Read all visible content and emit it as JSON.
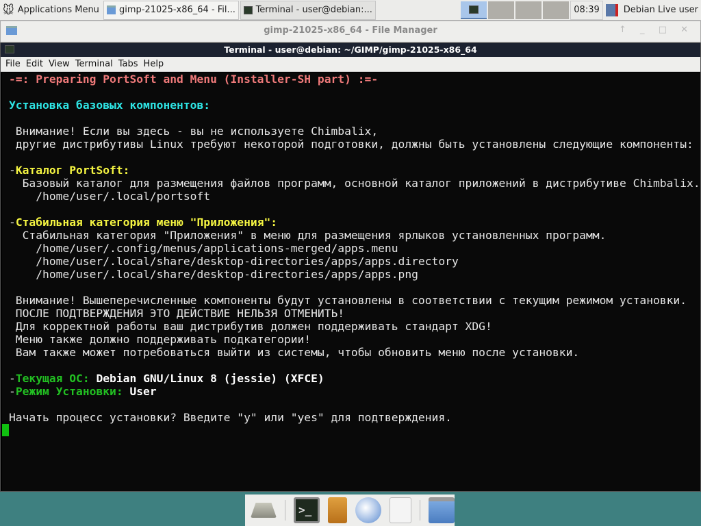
{
  "panel": {
    "app_menu": "Applications Menu",
    "tasks": [
      {
        "label": "gimp-21025-x86_64 - Fil...",
        "icon": "folder-icon"
      },
      {
        "label": "Terminal - user@debian:...",
        "icon": "terminal-icon"
      }
    ],
    "clock": "08:39",
    "user": "Debian Live user"
  },
  "file_manager": {
    "title": "gimp-21025-x86_64 - File Manager"
  },
  "terminal": {
    "title": "Terminal - user@debian: ~/GIMP/gimp-21025-x86_64",
    "menu": [
      "File",
      "Edit",
      "View",
      "Terminal",
      "Tabs",
      "Help"
    ],
    "colors": {
      "red": "#f07a7a",
      "cyan": "#2ee6e6",
      "yellow": "#f5f542",
      "green": "#22c022",
      "white": "#ffffff",
      "default": "#e6e6e6"
    },
    "lines": [
      [
        {
          "t": "-=: Preparing PortSoft and Menu (Installer-SH part) :=-",
          "c": "red",
          "b": true
        }
      ],
      [],
      [
        {
          "t": "Установка базовых компонентов:",
          "c": "cyan",
          "b": true
        }
      ],
      [],
      [
        {
          "t": " Внимание! Если вы здесь - вы не используете Chimbalix,"
        }
      ],
      [
        {
          "t": " другие дистрибутивы Linux требуют некоторой подготовки, должны быть установлены следующие компоненты:"
        }
      ],
      [],
      [
        {
          "t": "-"
        },
        {
          "t": "Каталог PortSoft:",
          "c": "yellow",
          "b": true
        }
      ],
      [
        {
          "t": "  Базовый каталог для размещения файлов программ, основной каталог приложений в дистрибутиве Chimbalix."
        }
      ],
      [
        {
          "t": "    /home/user/.local/portsoft"
        }
      ],
      [],
      [
        {
          "t": "-"
        },
        {
          "t": "Стабильная категория меню \"Приложения\":",
          "c": "yellow",
          "b": true
        }
      ],
      [
        {
          "t": "  Стабильная категория \"Приложения\" в меню для размещения ярлыков установленных программ."
        }
      ],
      [
        {
          "t": "    /home/user/.config/menus/applications-merged/apps.menu"
        }
      ],
      [
        {
          "t": "    /home/user/.local/share/desktop-directories/apps/apps.directory"
        }
      ],
      [
        {
          "t": "    /home/user/.local/share/desktop-directories/apps/apps.png"
        }
      ],
      [],
      [
        {
          "t": " Внимание! Вышеперечисленные компоненты будут установлены в соответствии с текущим режимом установки."
        }
      ],
      [
        {
          "t": " ПОСЛЕ ПОДТВЕРЖДЕНИЯ ЭТО ДЕЙСТВИЕ НЕЛЬЗЯ ОТМЕНИТЬ!"
        }
      ],
      [
        {
          "t": " Для корректной работы ваш дистрибутив должен поддерживать стандарт XDG!"
        }
      ],
      [
        {
          "t": " Меню также должно поддерживать подкатегории!"
        }
      ],
      [
        {
          "t": " Вам также может потребоваться выйти из системы, чтобы обновить меню после установки."
        }
      ],
      [],
      [
        {
          "t": "-"
        },
        {
          "t": "Текущая ОС: ",
          "c": "green",
          "b": true
        },
        {
          "t": "Debian GNU/Linux 8 (jessie) (XFCE)",
          "c": "white",
          "b": true
        }
      ],
      [
        {
          "t": "-"
        },
        {
          "t": "Режим Установки: ",
          "c": "green",
          "b": true
        },
        {
          "t": "User",
          "c": "white",
          "b": true
        }
      ],
      [],
      [
        {
          "t": "Начать процесс установки? Введите \"y\" или \"yes\" для подтверждения."
        }
      ]
    ]
  },
  "dock": [
    "show-desktop-icon",
    "terminal-icon",
    "file-cabinet-icon",
    "web-browser-icon",
    "app-finder-icon",
    "folder-icon"
  ]
}
